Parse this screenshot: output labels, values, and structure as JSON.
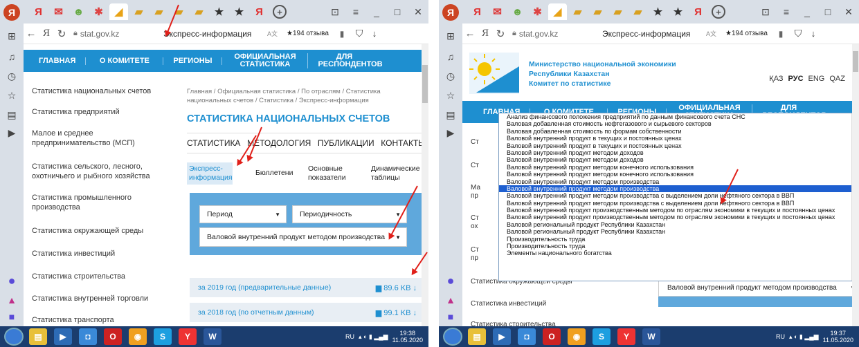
{
  "browser": {
    "url": "stat.gov.kz",
    "page_title": "Экспресс-информация",
    "translate_label": "A文",
    "reviews_label": "★194 отзыва"
  },
  "site": {
    "ministry_lines": [
      "Министерство национальной экономики",
      "Республики Казахстан",
      "Комитет по статистике"
    ],
    "languages": [
      "ҚАЗ",
      "РУС",
      "ENG",
      "QAZ"
    ],
    "active_language": "РУС",
    "nav": [
      "ГЛАВНАЯ",
      "О КОМИТЕТЕ",
      "РЕГИОНЫ",
      "ОФИЦИАЛЬНАЯ СТАТИСТИКА",
      "ДЛЯ РЕСПОНДЕНТОВ"
    ],
    "left_menu": [
      "Статистика национальных счетов",
      "Статистика предприятий",
      "Малое и среднее предпринимательство (МСП)",
      "Статистика сельского, лесного, охотничьего и рыбного хозяйства",
      "Статистика промышленного производства",
      "Статистика окружающей среды",
      "Статистика инвестиций",
      "Статистика строительства",
      "Статистика внутренней торговли",
      "Статистика транспорта"
    ],
    "breadcrumb": "Главная / Официальная статистика / По отраслям / Статистика национальных счетов / Статистика / Экспресс-информация",
    "section_title": "СТАТИСТИКА НАЦИОНАЛЬНЫХ СЧЕТОВ",
    "tabs": [
      "СТАТИСТИКА",
      "МЕТОДОЛОГИЯ",
      "ПУБЛИКАЦИИ",
      "КОНТАКТЫ"
    ],
    "subtabs": [
      "Экспресс-информация",
      "Бюллетени",
      "Основные показатели",
      "Динамические таблицы"
    ],
    "filter": {
      "period": "Период",
      "periodicity": "Периодичность",
      "indicator": "Валовой внутренний продукт методом производства"
    },
    "files": [
      {
        "label": "за 2019 год (предварительные данные)",
        "size": "89.6 KB"
      },
      {
        "label": "за 2018 год (по отчетным данным)",
        "size": "99.1 KB"
      }
    ],
    "dropdown_options": [
      "Анализ финансового положения предприятий по данным финансового счета СНС",
      "Валовая добавленная стоимость нефтегазового и сырьевого секторов",
      "Валовая добавленная стоимость по формам собственности",
      "Валовой внутренний продукт в текущих и постоянных ценах",
      "Валовой внутренний продукт в текущих и постоянных ценах",
      "Валовой внутренний продукт методом доходов",
      "Валовой внутренний продукт методом доходов",
      "Валовой внутренний продукт методом конечного использования",
      "Валовой внутренний продукт методом конечного использования",
      "Валовой внутренний продукт методом производства",
      "Валовой внутренний продукт методом производства",
      "Валовой внутренний продукт методом производства с выделением доли нефтяного сектора в ВВП",
      "Валовой внутренний продукт методом производства с выделением доли нефтяного сектора в ВВП",
      "Валовой внутренний продукт производственным методом по отраслям экономики в текущих и постоянных ценах",
      "Валовой внутренний продукт производственным методом по отраслям экономики в текущих и постоянных ценах",
      "Валовой региональный продукт Республики Казахстан",
      "Валовой региональный продукт Республики Казахстан",
      "Производительность труда",
      "Производительность труда",
      "Элементы национального богатства"
    ],
    "highlighted_option_index": 10
  },
  "taskbar": {
    "lang": "RU",
    "time_left": "19:38",
    "date_left": "11.05.2020",
    "time_right": "19:37",
    "date_right": "11.05.2020"
  }
}
